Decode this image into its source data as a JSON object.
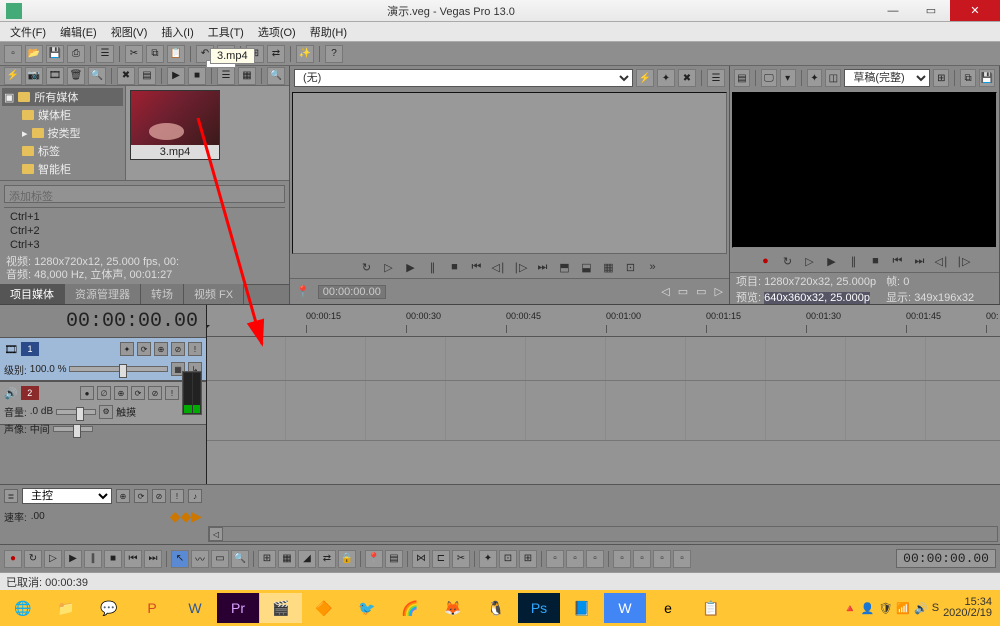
{
  "window": {
    "title": "演示.veg - Vegas Pro 13.0"
  },
  "menu": {
    "file": "文件(F)",
    "edit": "编辑(E)",
    "view": "视图(V)",
    "insert": "插入(I)",
    "tools": "工具(T)",
    "options": "选项(O)",
    "help": "帮助(H)"
  },
  "media_tree": {
    "root": "所有媒体",
    "c1": "媒体柜",
    "c2": "按类型",
    "c3": "标签",
    "c4": "智能柜"
  },
  "thumb": {
    "label": "3.mp4",
    "tooltip": "3.mp4"
  },
  "tagbox": {
    "placeholder": "添加标签"
  },
  "ctrl": {
    "l1": "Ctrl+1",
    "l2": "Ctrl+2",
    "l3": "Ctrl+3"
  },
  "media_info": {
    "l1": "视频: 1280x720x12, 25.000 fps, 00:",
    "l2": "音频: 48,000 Hz, 立体声, 00:01:27"
  },
  "tabs_left": {
    "t1": "项目媒体",
    "t2": "资源管理器",
    "t3": "转场",
    "t4": "视频 FX"
  },
  "fx": {
    "none": "(无)"
  },
  "trimmer_tc": "00:00:00.00",
  "preview_info": {
    "proj_l": "项目:",
    "proj_v": "1280x720x32, 25.000p",
    "frame_l": "帧:",
    "frame_v": "0",
    "prev_l": "预览:",
    "prev_v": "640x360x32, 25.000p",
    "disp_l": "显示:",
    "disp_v": "349x196x32"
  },
  "preview_quality": "草稿(完整)",
  "timecode": "00:00:00.00",
  "ruler": [
    "00:00:15",
    "00:00:30",
    "00:00:45",
    "00:01:00",
    "00:01:15",
    "00:01:30",
    "00:01:45",
    "00:"
  ],
  "track_v": {
    "num": "1",
    "level_l": "级别:",
    "level_v": "100.0 %"
  },
  "track_a": {
    "num": "2",
    "vol_l": "音量:",
    "vol_v": ".0 dB",
    "pan_l": "声像:",
    "pan_v": "中间",
    "touch": "触摸"
  },
  "master": {
    "label": "主控",
    "rate_l": "速率:",
    "rate_v": ".00"
  },
  "bottom_tc": "00:00:00.00",
  "status": {
    "text": "已取消: 00:00:39"
  },
  "clock": {
    "time": "15:34",
    "date": "2020/2/19"
  }
}
